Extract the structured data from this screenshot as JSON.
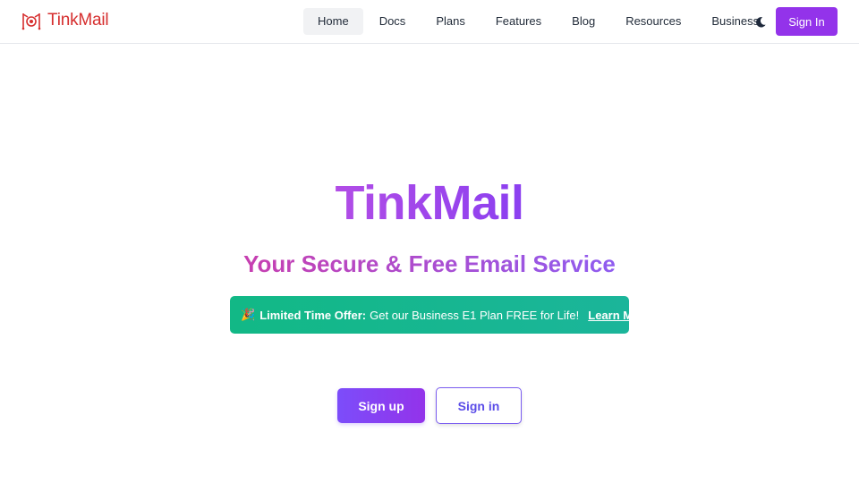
{
  "header": {
    "brand_name": "TinkMail",
    "nav": [
      {
        "label": "Home",
        "active": true
      },
      {
        "label": "Docs",
        "active": false
      },
      {
        "label": "Plans",
        "active": false
      },
      {
        "label": "Features",
        "active": false
      },
      {
        "label": "Blog",
        "active": false
      },
      {
        "label": "Resources",
        "active": false
      },
      {
        "label": "Business",
        "active": false
      }
    ],
    "theme_icon": "moon-icon",
    "signin_label": "Sign In"
  },
  "hero": {
    "title": "TinkMail",
    "subtitle": "Your Secure & Free Email Service",
    "offer": {
      "emoji": "🎉",
      "strong": "Limited Time Offer:",
      "text": "Get our Business E1 Plan FREE for Life!",
      "link": "Learn More"
    },
    "signup_label": "Sign up",
    "signin_label": "Sign in"
  },
  "colors": {
    "brand_red": "#d62f2f",
    "accent_purple": "#9333ea",
    "offer_green": "#12b886"
  }
}
